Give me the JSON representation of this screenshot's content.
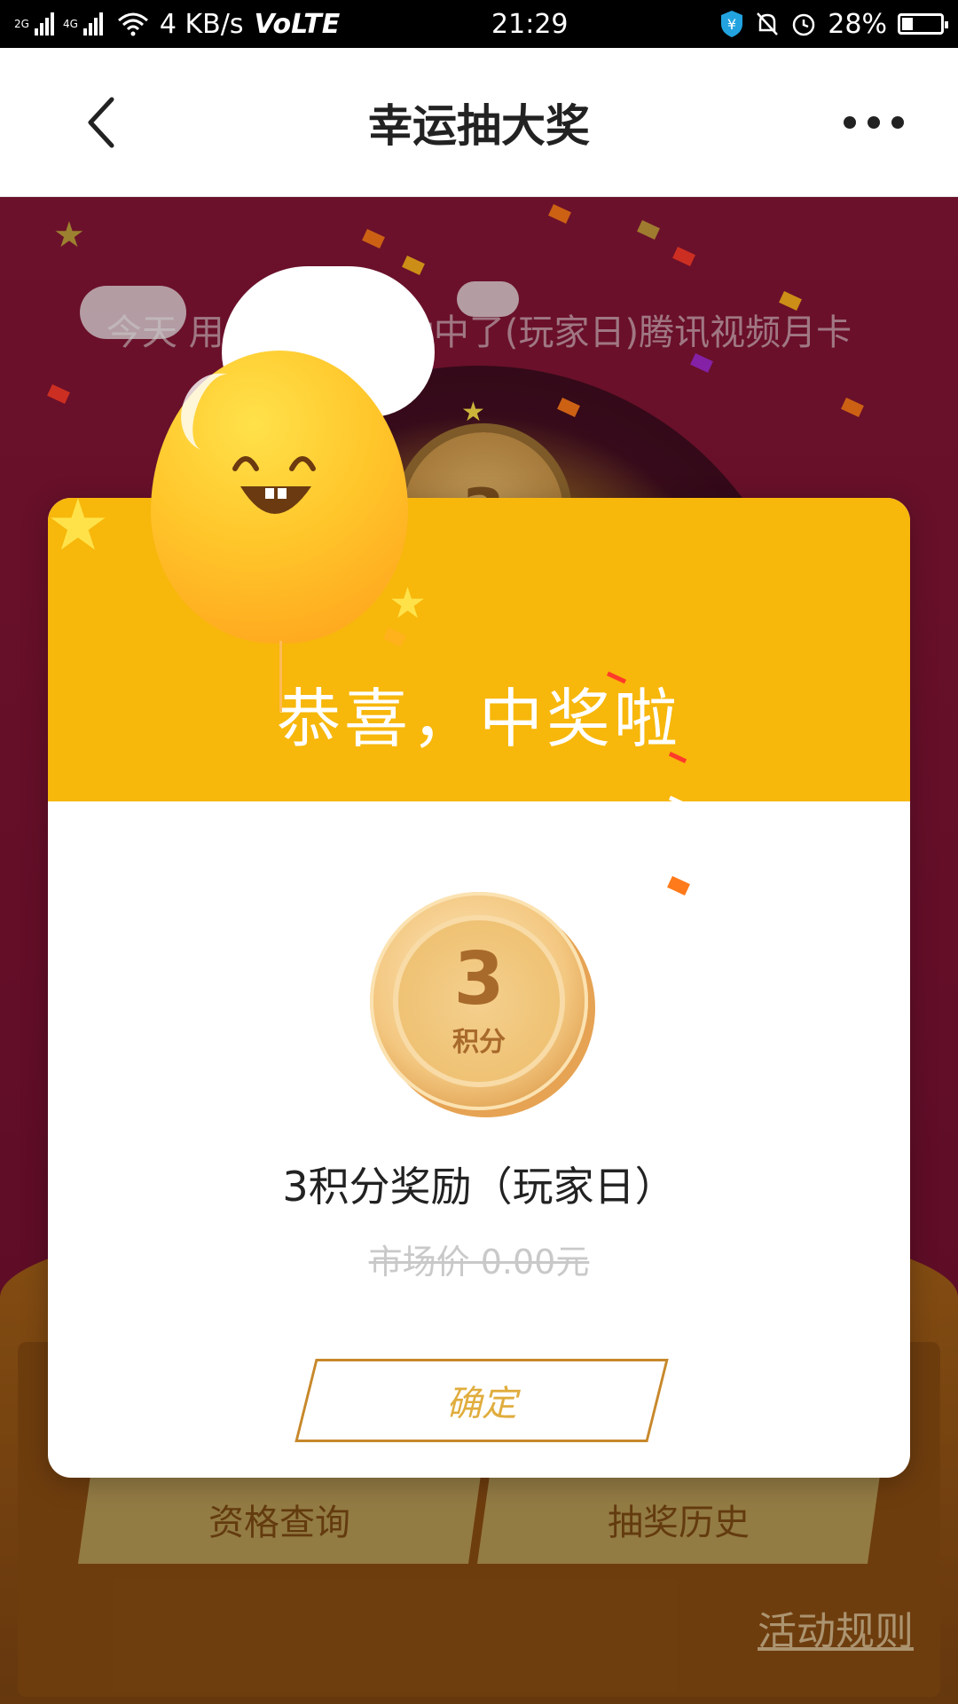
{
  "status_bar": {
    "network_left": "2G",
    "network_right": "4G",
    "speed": "4 KB/s",
    "volte": "VoLTE",
    "time": "21:29",
    "battery": "28%"
  },
  "header": {
    "title": "幸运抽大奖"
  },
  "marquee": {
    "text": "今天 用户138****抽中了(玩家日)腾讯视频月卡"
  },
  "wheel": {
    "center_label": "3"
  },
  "modal": {
    "congrats": "恭喜，中奖啦",
    "coin_value": "3",
    "coin_unit": "积分",
    "prize_name": "3积分奖励（玩家日）",
    "market_price": "市场价 0.00元",
    "confirm_label": "确定"
  },
  "bottom_tabs": {
    "qualification": "资格查询",
    "history": "抽奖历史"
  },
  "rules_link": "活动规则",
  "colors": {
    "modal_header": "#f7b70b",
    "scene_bg": "#871636",
    "button_border": "#c7882a"
  }
}
